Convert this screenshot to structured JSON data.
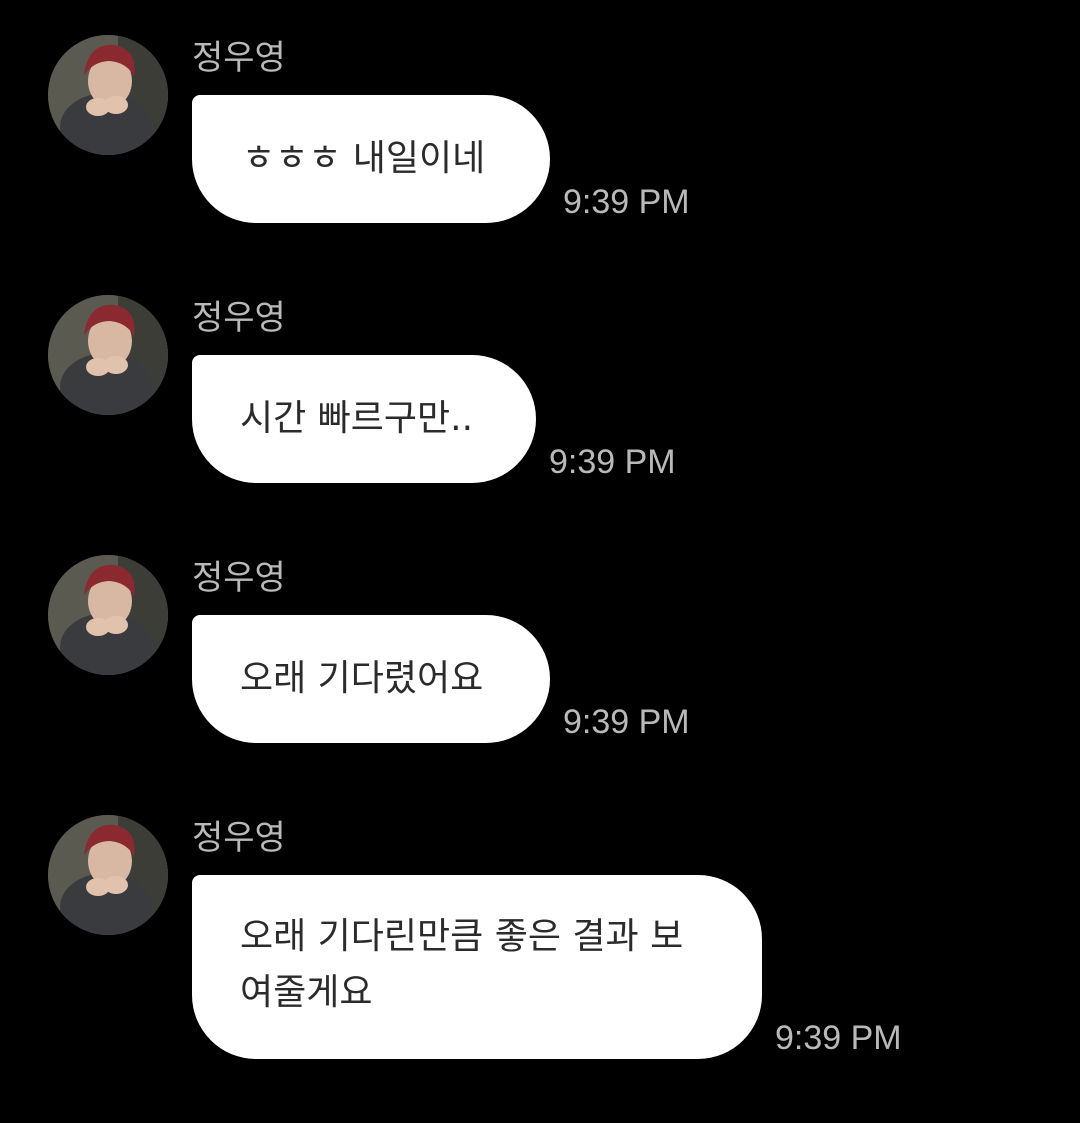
{
  "messages": [
    {
      "sender": "정우영",
      "text": "ㅎㅎㅎ 내일이네",
      "time": "9:39 PM"
    },
    {
      "sender": "정우영",
      "text": "시간 빠르구만..",
      "time": "9:39 PM"
    },
    {
      "sender": "정우영",
      "text": "오래 기다렸어요",
      "time": "9:39 PM"
    },
    {
      "sender": "정우영",
      "text": "오래 기다린만큼 좋은 결과 보\n여줄게요",
      "time": "9:39 PM"
    }
  ],
  "colors": {
    "background": "#000000",
    "bubble": "#ffffff",
    "bubble_text": "#2b2b2b",
    "meta_text": "#b9b9b9"
  },
  "icons": {
    "avatar": "profile-photo"
  }
}
